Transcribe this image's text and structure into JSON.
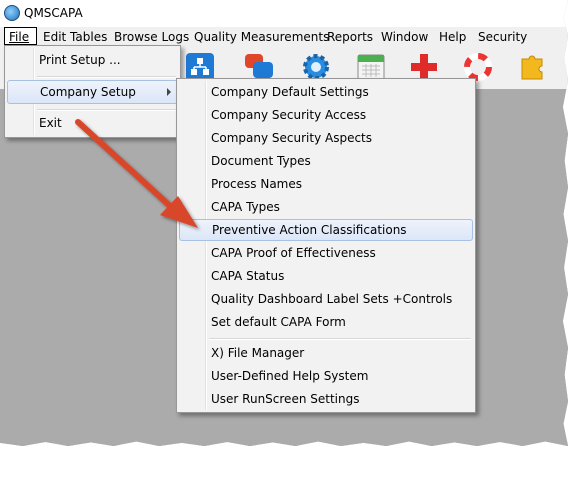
{
  "window": {
    "title": "QMSCAPA"
  },
  "menubar": {
    "items": [
      {
        "label": "File"
      },
      {
        "label": "Edit Tables"
      },
      {
        "label": "Browse Logs"
      },
      {
        "label": "Quality Measurements"
      },
      {
        "label": "Reports"
      },
      {
        "label": "Window"
      },
      {
        "label": "Help"
      },
      {
        "label": "Security"
      }
    ]
  },
  "file_menu": {
    "items": [
      {
        "label": "Print Setup ..."
      },
      {
        "label": "Company Setup"
      },
      {
        "label": "Exit"
      }
    ]
  },
  "company_setup_menu": {
    "items": [
      {
        "label": "Company Default Settings"
      },
      {
        "label": "Company Security Access"
      },
      {
        "label": "Company Security Aspects"
      },
      {
        "label": "Document Types"
      },
      {
        "label": "Process Names"
      },
      {
        "label": "CAPA Types"
      },
      {
        "label": "Preventive Action Classifications"
      },
      {
        "label": "CAPA Proof of Effectiveness"
      },
      {
        "label": "CAPA Status"
      },
      {
        "label": "Quality Dashboard Label Sets +Controls"
      },
      {
        "label": "Set default CAPA Form"
      },
      {
        "label": "X) File Manager"
      },
      {
        "label": "User-Defined Help System"
      },
      {
        "label": "User RunScreen Settings"
      }
    ],
    "highlighted": "Preventive Action Classifications"
  },
  "toolbar": {
    "icons": [
      "org-chart-icon",
      "chat-bubbles-icon",
      "gear-icon",
      "calendar-icon",
      "red-cross-icon",
      "lifebuoy-icon",
      "puzzle-icon"
    ]
  },
  "colors": {
    "annotation_arrow": "#d9472b",
    "workspace": "#ababab",
    "highlight": "#dbe6f7"
  }
}
